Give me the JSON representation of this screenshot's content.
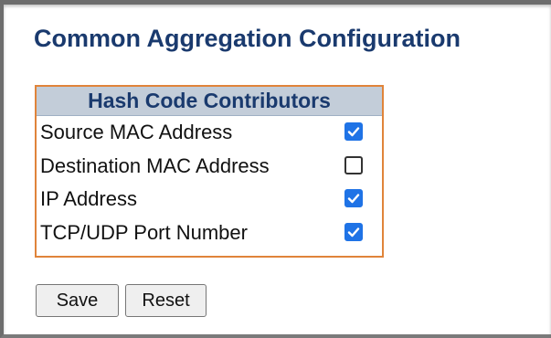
{
  "page": {
    "title": "Common Aggregation Configuration"
  },
  "hash_table": {
    "header": "Hash Code Contributors",
    "rows": [
      {
        "label": "Source MAC Address",
        "checked": true
      },
      {
        "label": "Destination MAC Address",
        "checked": false
      },
      {
        "label": "IP Address",
        "checked": true
      },
      {
        "label": "TCP/UDP Port Number",
        "checked": true
      }
    ]
  },
  "buttons": {
    "save_label": "Save",
    "reset_label": "Reset"
  },
  "colors": {
    "title_text": "#1a3a6e",
    "table_border": "#e0843a",
    "header_bg": "#c3cdd9",
    "checkbox_checked": "#1f73e6"
  }
}
